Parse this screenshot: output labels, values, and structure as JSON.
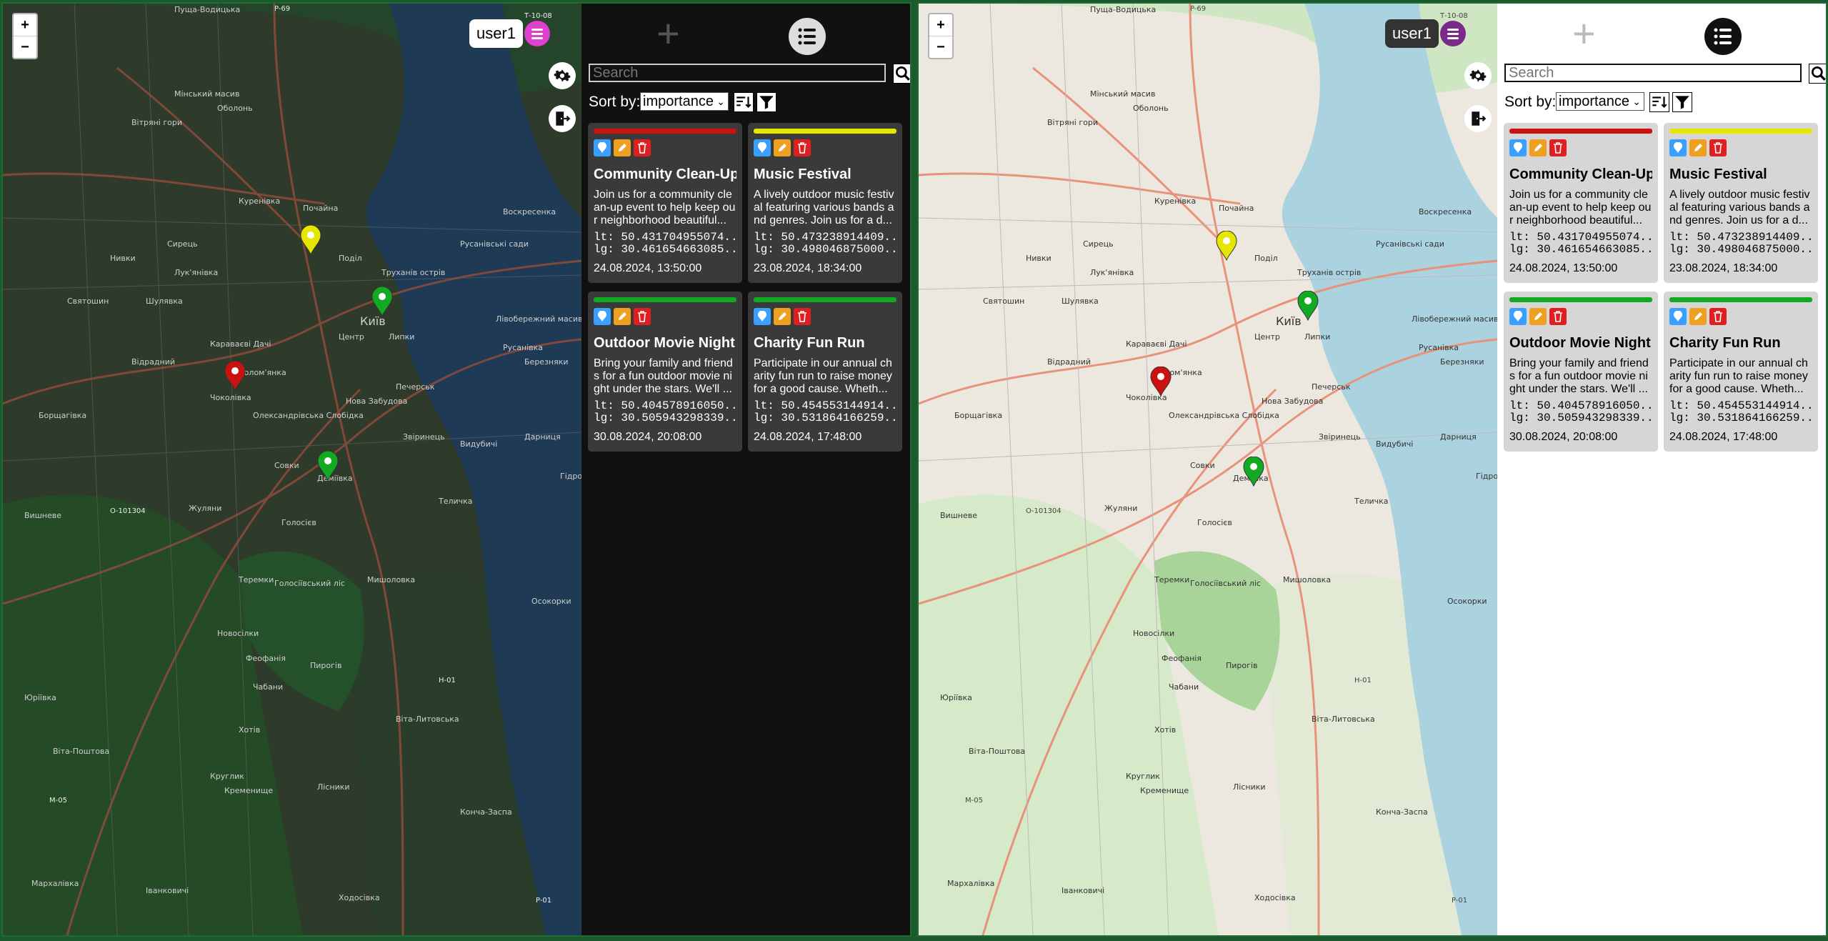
{
  "map": {
    "zoom_in": "+",
    "zoom_out": "−",
    "labels": [
      "Оболонь",
      "Мінський масив",
      "Вітряні гори",
      "Куренівка",
      "Почайна",
      "Поділ",
      "Сирець",
      "Нивки",
      "Лук'янівка",
      "Шулявка",
      "Святошин",
      "Київ",
      "Центр",
      "Липки",
      "Караваєві Дачі",
      "Відрадний",
      "Солом'янка",
      "Чоколівка",
      "Олександрівська Слобідка",
      "Нова Забудова",
      "Печерськ",
      "Звіринець",
      "Совки",
      "Деміївка",
      "Жуляни",
      "Голосієв",
      "Теремки",
      "Вишневе",
      "Новосілки",
      "Фeофанія",
      "Пирогів",
      "Чабани",
      "Юріївка",
      "Хотів",
      "Віта-Поштова",
      "Віта-Литовська",
      "Круглик",
      "Кременище",
      "Лісники",
      "Ходосівка",
      "Іванковичі",
      "Мархалівка",
      "Конча-Заспа",
      "Лівобережний масив",
      "Русанівка",
      "Березняки",
      "Воскресенка",
      "Русанівські сади",
      "Дарниця",
      "Теличка",
      "Видубичі",
      "Мишоловка",
      "Голосіївський ліс",
      "Осокорки",
      "Труханів острів",
      "Гідропарк",
      "Борщагівка",
      "Пуща-Водицька"
    ],
    "road_labels": [
      "P-69",
      "H-01",
      "M-05",
      "P-01",
      "О-101304",
      "Т-10-08"
    ],
    "markers": [
      "yellow",
      "green",
      "red",
      "green"
    ]
  },
  "header": {
    "username": "user1",
    "add_button": "+"
  },
  "search": {
    "placeholder": "Search"
  },
  "sort": {
    "label": "Sort by:",
    "selected": "importance"
  },
  "colors": {
    "red": "#cc1111",
    "yellow": "#e6e600",
    "green": "#11aa22"
  },
  "events": [
    {
      "color": "red",
      "title": "Community Clean-Up",
      "description": "Join us for a community clean-up event to help keep our neighborhood beautiful...",
      "lt": "lt: 50.431704955074...",
      "lg": "lg: 30.461654663085...",
      "date": "24.08.2024, 13:50:00"
    },
    {
      "color": "yellow",
      "title": "Music Festival",
      "description": "A lively outdoor music festival featuring various bands and genres. Join us for a d...",
      "lt": "lt: 50.473238914409...",
      "lg": "lg: 30.498046875000...",
      "date": "23.08.2024, 18:34:00"
    },
    {
      "color": "green",
      "title": "Outdoor Movie Night",
      "description": "Bring your family and friends for a fun outdoor movie night under the stars. We'll ...",
      "lt": "lt: 50.404578916050...",
      "lg": "lg: 30.505943298339...",
      "date": "30.08.2024, 20:08:00"
    },
    {
      "color": "green",
      "title": "Charity Fun Run",
      "description": "Participate in our annual charity fun run to raise money for a good cause. Wheth...",
      "lt": "lt: 50.454553144914...",
      "lg": "lg: 30.531864166259...",
      "date": "24.08.2024, 17:48:00"
    }
  ]
}
